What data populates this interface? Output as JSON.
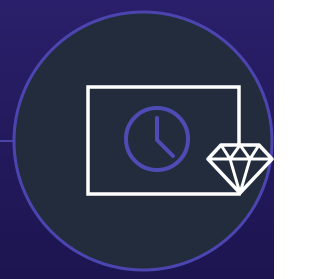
{
  "colors": {
    "background_top": "#2a1f6a",
    "background_bottom": "#1c1550",
    "circle_fill": "#222c3c",
    "circle_border": "#4c45b0",
    "frame_stroke": "#ffffff",
    "clock_stroke": "#4f4bb5",
    "diamond_stroke": "#ffffff"
  },
  "icons": {
    "frame": "screen-frame-icon",
    "clock": "clock-icon",
    "diamond": "diamond-icon"
  }
}
